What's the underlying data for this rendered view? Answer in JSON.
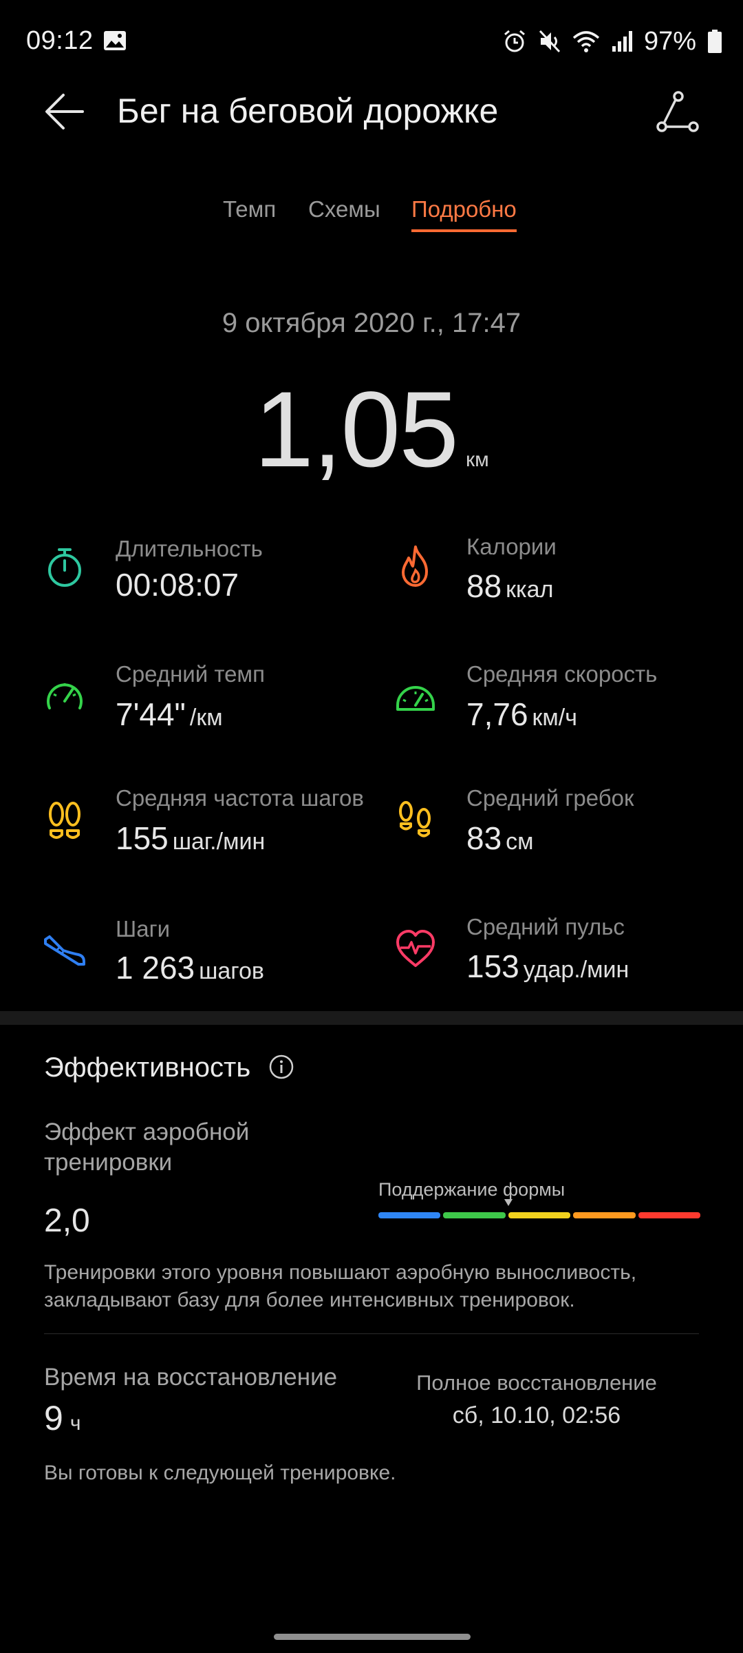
{
  "status_bar": {
    "time": "09:12",
    "battery": "97%",
    "icons": [
      "gallery-icon",
      "alarm-icon",
      "mute-icon",
      "wifi-icon",
      "signal-icon",
      "battery-icon"
    ]
  },
  "header": {
    "title": "Бег на беговой дорожке"
  },
  "tabs": [
    {
      "label": "Темп",
      "active": false
    },
    {
      "label": "Схемы",
      "active": false
    },
    {
      "label": "Подробно",
      "active": true
    }
  ],
  "summary": {
    "date": "9 октября 2020 г., 17:47",
    "distance": "1,05",
    "distance_unit": "км"
  },
  "metrics": [
    {
      "label": "Длительность",
      "value": "00:08:07",
      "unit": "",
      "icon": "stopwatch-icon",
      "color": "#2ec8a0"
    },
    {
      "label": "Калории",
      "value": "88",
      "unit": "ккал",
      "icon": "flame-icon",
      "color": "#ff6a33"
    },
    {
      "label": "Средний темп",
      "value": "7'44\"",
      "unit": "/км",
      "icon": "pace-gauge-icon",
      "color": "#34d34a"
    },
    {
      "label": "Средняя скорость",
      "value": "7,76",
      "unit": "км/ч",
      "icon": "speedometer-icon",
      "color": "#34d34a"
    },
    {
      "label": "Средняя частота шагов",
      "value": "155",
      "unit": "шаг./мин",
      "icon": "footprints-icon",
      "color": "#ffbf1f"
    },
    {
      "label": "Средний гребок",
      "value": "83",
      "unit": "см",
      "icon": "footprints-icon",
      "color": "#ffbf1f"
    },
    {
      "label": "Шаги",
      "value": "1 263",
      "unit": "шагов",
      "icon": "shoe-icon",
      "color": "#2f7ff2"
    },
    {
      "label": "Средний пульс",
      "value": "153",
      "unit": "удар./мин",
      "icon": "heart-pulse-icon",
      "color": "#ff3b66"
    }
  ],
  "efficiency": {
    "title": "Эффективность",
    "aerobic_label": "Эффект аэробной тренировки",
    "aerobic_value": "2,0",
    "zone_label": "Поддержание формы",
    "zone_colors": [
      "#2f86f5",
      "#3ec84a",
      "#f2d21e",
      "#ff9a1f",
      "#ff3a2f"
    ],
    "zone_level": 2.0,
    "description": "Тренировки этого уровня повышают аэробную выносливость, закладывают базу для более интенсивных тренировок.",
    "recovery_label": "Время на восстановление",
    "recovery_value": "9",
    "recovery_unit": "ч",
    "full_recovery_label": "Полное восстановление",
    "full_recovery_value": "сб, 10.10, 02:56",
    "ready_text": "Вы готовы к следующей тренировке."
  }
}
